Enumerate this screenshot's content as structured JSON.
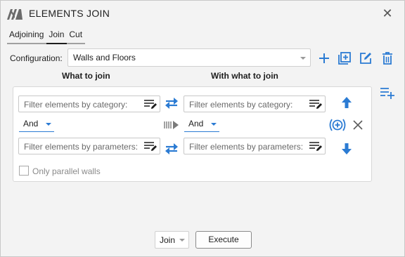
{
  "window": {
    "title": "ELEMENTS JOIN"
  },
  "tabs": [
    {
      "label": "Adjoining"
    },
    {
      "label": "Join"
    },
    {
      "label": "Cut"
    }
  ],
  "configuration": {
    "label": "Configuration:",
    "value": "Walls and Floors"
  },
  "columns": {
    "left": "What to join",
    "right": "With what to join"
  },
  "left": {
    "category_placeholder": "Filter elements by category:",
    "operator": "And",
    "parameters_placeholder": "Filter elements by parameters:"
  },
  "right": {
    "category_placeholder": "Filter elements by category:",
    "operator": "And",
    "parameters_placeholder": "Filter elements by parameters:"
  },
  "options": {
    "parallel_walls_label": "Only parallel walls",
    "parallel_walls_checked": false
  },
  "footer": {
    "mode_value": "Join",
    "execute_label": "Execute"
  },
  "colors": {
    "accent": "#2b7bd3",
    "text": "#1e1e1e",
    "muted": "#6a6a6a"
  },
  "icons": [
    "app-logo-icon",
    "close-icon",
    "add-icon",
    "duplicate-icon",
    "edit-icon",
    "delete-icon",
    "add-rule-icon",
    "list-edit-icon",
    "swap-arrows-icon",
    "link-arrow-icon",
    "arrow-up-icon",
    "arrow-down-icon",
    "add-circle-icon",
    "remove-icon",
    "chevron-down-icon"
  ]
}
